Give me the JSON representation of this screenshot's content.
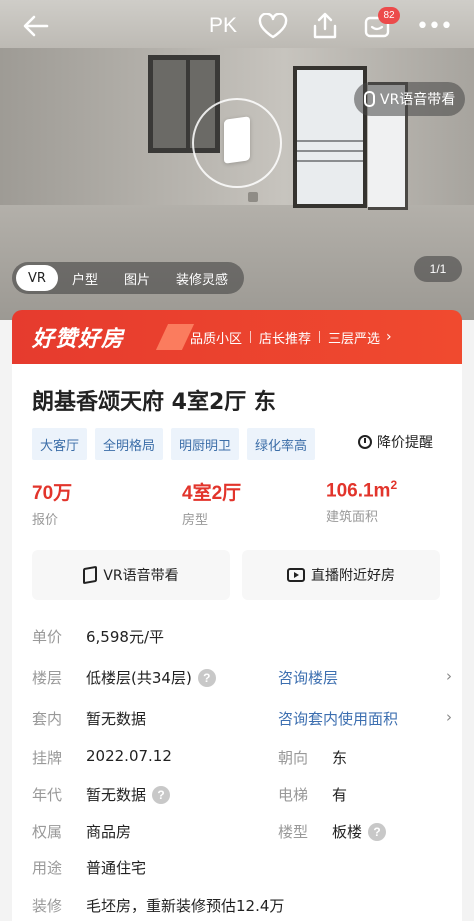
{
  "topbar": {
    "pk_label": "PK",
    "message_badge": "82"
  },
  "hero": {
    "vr_pill_label": "VR语音带看",
    "tabs": [
      {
        "label": "VR",
        "active": true
      },
      {
        "label": "户型",
        "active": false
      },
      {
        "label": "图片",
        "active": false
      },
      {
        "label": "装修灵感",
        "active": false
      }
    ],
    "counter": "1/1"
  },
  "promo": {
    "logo_text": "好赞好房",
    "items": [
      "品质小区",
      "店长推荐",
      "三层严选"
    ]
  },
  "listing": {
    "title": "朗基香颂天府 4室2厅 东",
    "tags": [
      "大客厅",
      "全明格局",
      "明厨明卫",
      "绿化率高"
    ],
    "price_alert_label": "降价提醒",
    "stats": {
      "price": {
        "value": "70万",
        "label": "报价"
      },
      "layout": {
        "value": "4室2厅",
        "label": "房型"
      },
      "area": {
        "value": "106.1m",
        "sup": "2",
        "label": "建筑面积"
      }
    },
    "buttons": {
      "vr": "VR语音带看",
      "live": "直播附近好房"
    },
    "info": {
      "unit_price": {
        "key": "单价",
        "value": "6,598元/平"
      },
      "floor": {
        "key": "楼层",
        "value": "低楼层(共34层)",
        "link": "咨询楼层"
      },
      "inner": {
        "key": "套内",
        "value": "暂无数据",
        "link": "咨询套内使用面积"
      },
      "listed": {
        "key": "挂牌",
        "value": "2022.07.12",
        "key2": "朝向",
        "value2": "东"
      },
      "year": {
        "key": "年代",
        "value": "暂无数据",
        "key2": "电梯",
        "value2": "有"
      },
      "ownership": {
        "key": "权属",
        "value": "商品房",
        "key2": "楼型",
        "value2": "板楼"
      },
      "usage": {
        "key": "用途",
        "value": "普通住宅"
      },
      "decoration": {
        "key": "装修",
        "value": "毛坯房，重新装修预估12.4万"
      }
    }
  },
  "colors": {
    "accent_red": "#e2342b",
    "promo_red": "#e63b2e",
    "link_blue": "#3d6fb0",
    "tag_bg": "#ecf3fb"
  }
}
